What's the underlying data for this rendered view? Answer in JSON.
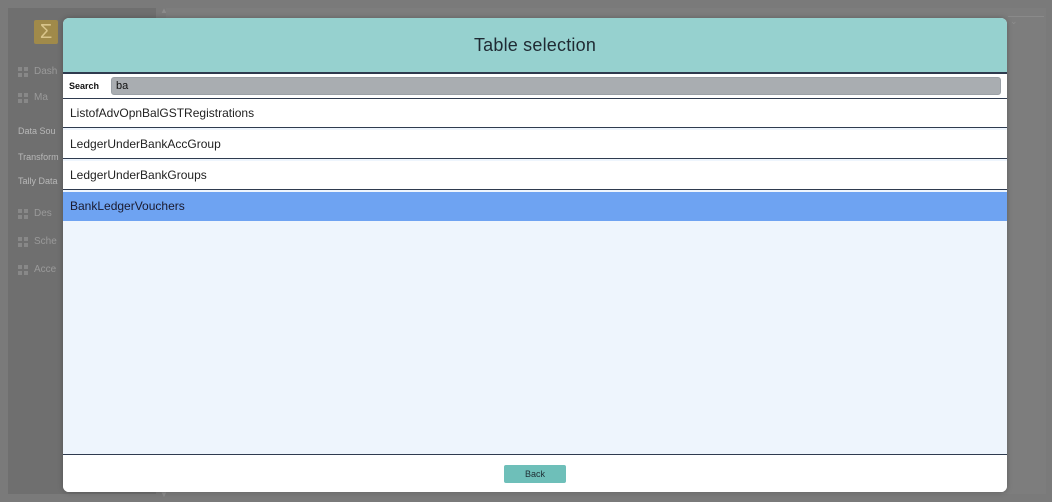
{
  "background": {
    "logo_glyph": "Σ",
    "nav_items": [
      "Dash",
      "Ma"
    ],
    "section_labels": [
      "Data Sou",
      "Transform",
      "Tally Data"
    ],
    "nav_items_lower": [
      "Des",
      "Sche",
      "Acce"
    ]
  },
  "modal": {
    "title": "Table selection",
    "search": {
      "label": "Search",
      "value": "ba"
    },
    "items": [
      {
        "label": "ListofAdvOpnBalGSTRegistrations",
        "selected": false
      },
      {
        "label": "LedgerUnderBankAccGroup",
        "selected": false
      },
      {
        "label": "LedgerUnderBankGroups",
        "selected": false
      },
      {
        "label": "BankLedgerVouchers",
        "selected": true
      }
    ],
    "back_label": "Back"
  },
  "colors": {
    "header": "#96d1cf",
    "selected_row": "#6ea3f2",
    "list_bg": "#eef5fd",
    "back_button": "#6ebfb9",
    "overlay": "#7a7a7a"
  }
}
